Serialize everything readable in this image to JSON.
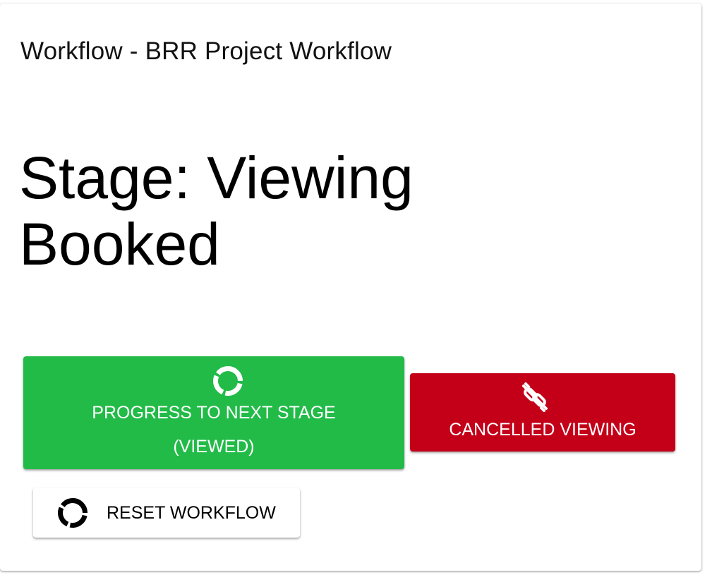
{
  "workflow": {
    "title": "Workflow - BRR Project Workflow",
    "stage_title": "Stage: Viewing Booked"
  },
  "actions": {
    "progress": {
      "label_line1": "PROGRESS TO NEXT STAGE",
      "label_line2": "(VIEWED)",
      "icon": "progress-ring-icon",
      "color": "#22bb48"
    },
    "cancel": {
      "label": "CANCELLED VIEWING",
      "icon": "broken-link-icon",
      "color": "#c40019"
    },
    "reset": {
      "label": "RESET WORKFLOW",
      "icon": "reset-ring-icon",
      "color": "#ffffff"
    }
  }
}
